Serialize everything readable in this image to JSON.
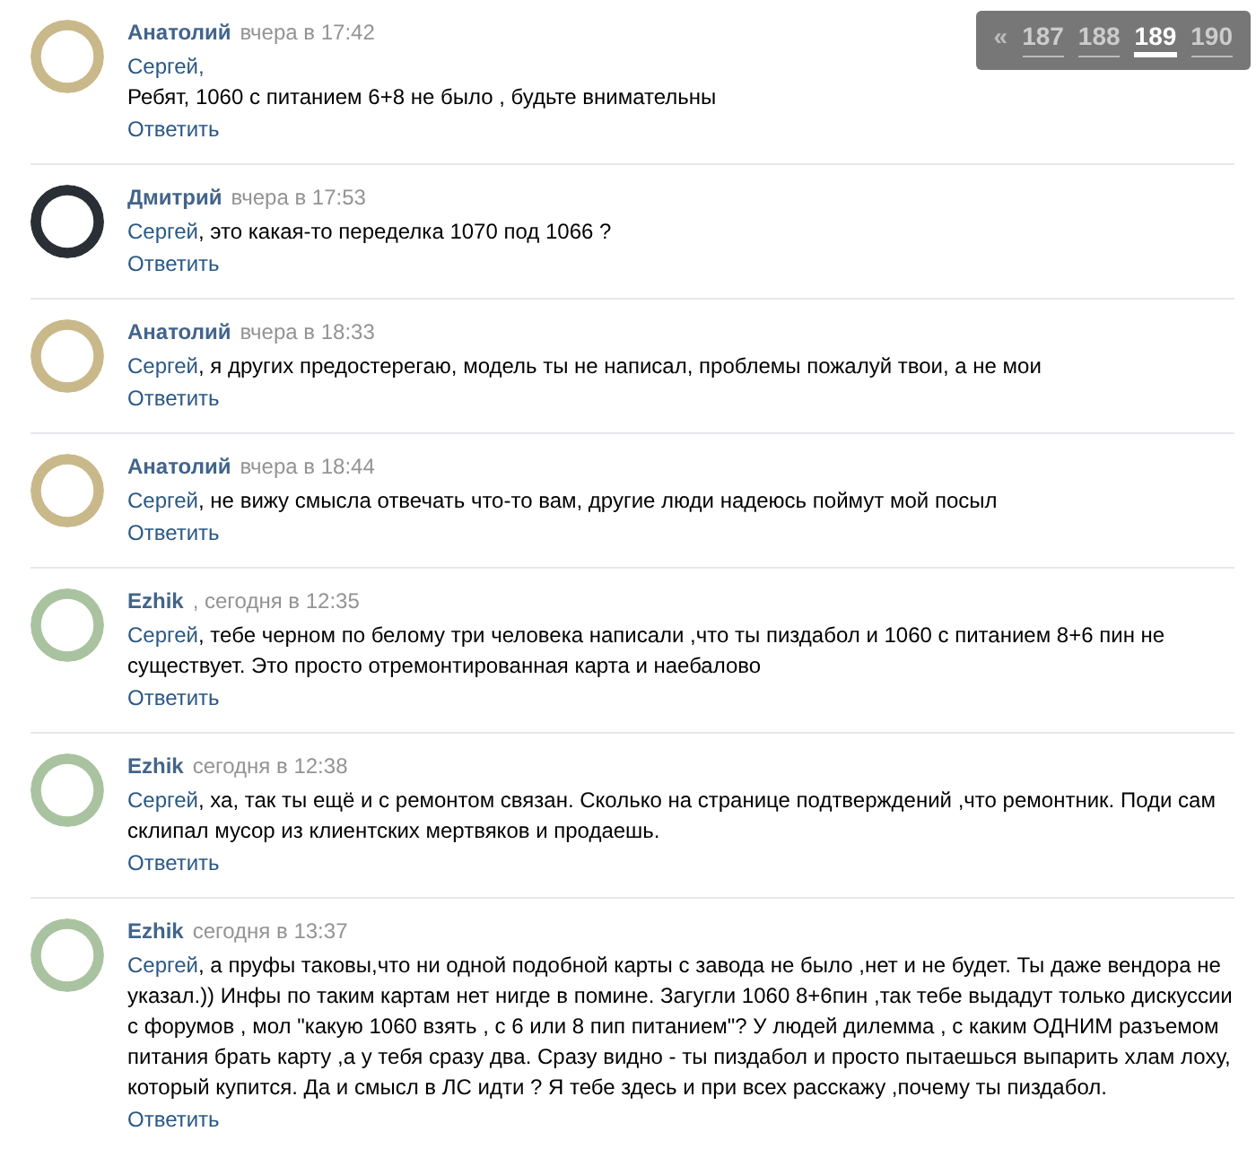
{
  "pagination": {
    "prev": "«",
    "pages": [
      {
        "label": "187",
        "selected": false
      },
      {
        "label": "188",
        "selected": false
      },
      {
        "label": "189",
        "selected": true
      },
      {
        "label": "190",
        "selected": false
      }
    ]
  },
  "comments": [
    {
      "author": "Анатолий",
      "color": "#c9b98a",
      "time": "вчера в 17:42",
      "mention": "Сергей,",
      "text": "\nРебят, 1060 с питанием 6+8 не было , будьте внимательны",
      "reply": "Ответить"
    },
    {
      "author": "Дмитрий",
      "color": "#2a2f36",
      "time": "вчера в 17:53",
      "mention": "Сергей",
      "text": ", это какая-то переделка 1070 под 1066 ?",
      "reply": "Ответить"
    },
    {
      "author": "Анатолий",
      "color": "#c9b98a",
      "time": "вчера в 18:33",
      "mention": "Сергей",
      "text": ", я других предостерегаю, модель ты не написал, проблемы пожалуй твои, а не мои",
      "reply": "Ответить"
    },
    {
      "author": "Анатолий",
      "color": "#c9b98a",
      "time": "вчера в 18:44",
      "mention": "Сергей",
      "text": ", не вижу смысла отвечать что-то вам, другие люди надеюсь поймут мой посыл",
      "reply": "Ответить"
    },
    {
      "author": "Ezhik",
      "color": "#a9c3a0",
      "time": ", сегодня в 12:35",
      "mention": "Сергей",
      "text": ", тебе черном по белому три человека написали ,что ты пиздабол и 1060 с питанием 8+6 пин не существует. Это просто отремонтированная карта и наебалово",
      "reply": "Ответить"
    },
    {
      "author": "Ezhik",
      "color": "#a9c3a0",
      "time": "сегодня в 12:38",
      "mention": "Сергей",
      "text": ", ха, так ты ещё и с ремонтом связан. Сколько на странице подтверждений ,что ремонтник. Поди сам склипал мусор из клиентских мертвяков и продаешь.",
      "reply": "Ответить"
    },
    {
      "author": "Ezhik",
      "color": "#a9c3a0",
      "time": "сегодня в 13:37",
      "mention": "Сергей",
      "text": ", а пруфы таковы,что ни одной подобной карты с завода не было ,нет и не будет. Ты даже вендора не указал.)) Инфы по таким картам нет нигде в помине. Загугли 1060 8+6пин ,так тебе выдадут только дискуссии с форумов , мол \"какую 1060 взять , с 6 или 8 пип питанием\"? У людей дилемма , с каким ОДНИМ разъемом питания брать карту ,а у тебя сразу два. Сразу видно - ты пиздабол и просто пытаешься выпарить хлам лоху, который купится. Да и смысл в ЛС идти ? Я тебе здесь и при всех расскажу ,почему ты пиздабол.",
      "reply": "Ответить"
    }
  ]
}
